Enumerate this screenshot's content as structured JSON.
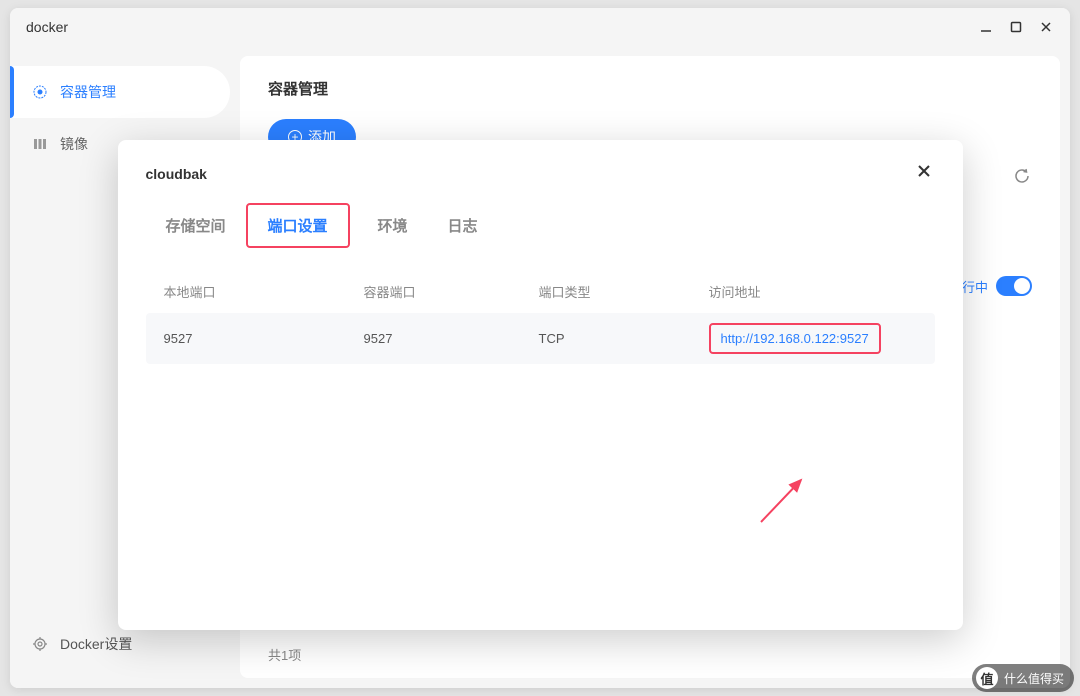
{
  "window": {
    "title": "docker"
  },
  "sidebar": {
    "items": [
      {
        "label": "容器管理"
      },
      {
        "label": "镜像"
      }
    ],
    "settings_label": "Docker设置"
  },
  "main": {
    "title": "容器管理",
    "add_label": "添加",
    "status_text": "行中",
    "footer": "共1项"
  },
  "modal": {
    "title": "cloudbak",
    "tabs": [
      {
        "label": "存储空间"
      },
      {
        "label": "端口设置"
      },
      {
        "label": "环境"
      },
      {
        "label": "日志"
      }
    ],
    "table": {
      "headers": {
        "local_port": "本地端口",
        "container_port": "容器端口",
        "port_type": "端口类型",
        "access_url": "访问地址"
      },
      "row": {
        "local_port": "9527",
        "container_port": "9527",
        "port_type": "TCP",
        "access_url": "http://192.168.0.122:9527"
      }
    }
  },
  "watermark": {
    "icon": "值",
    "text": "什么值得买"
  }
}
